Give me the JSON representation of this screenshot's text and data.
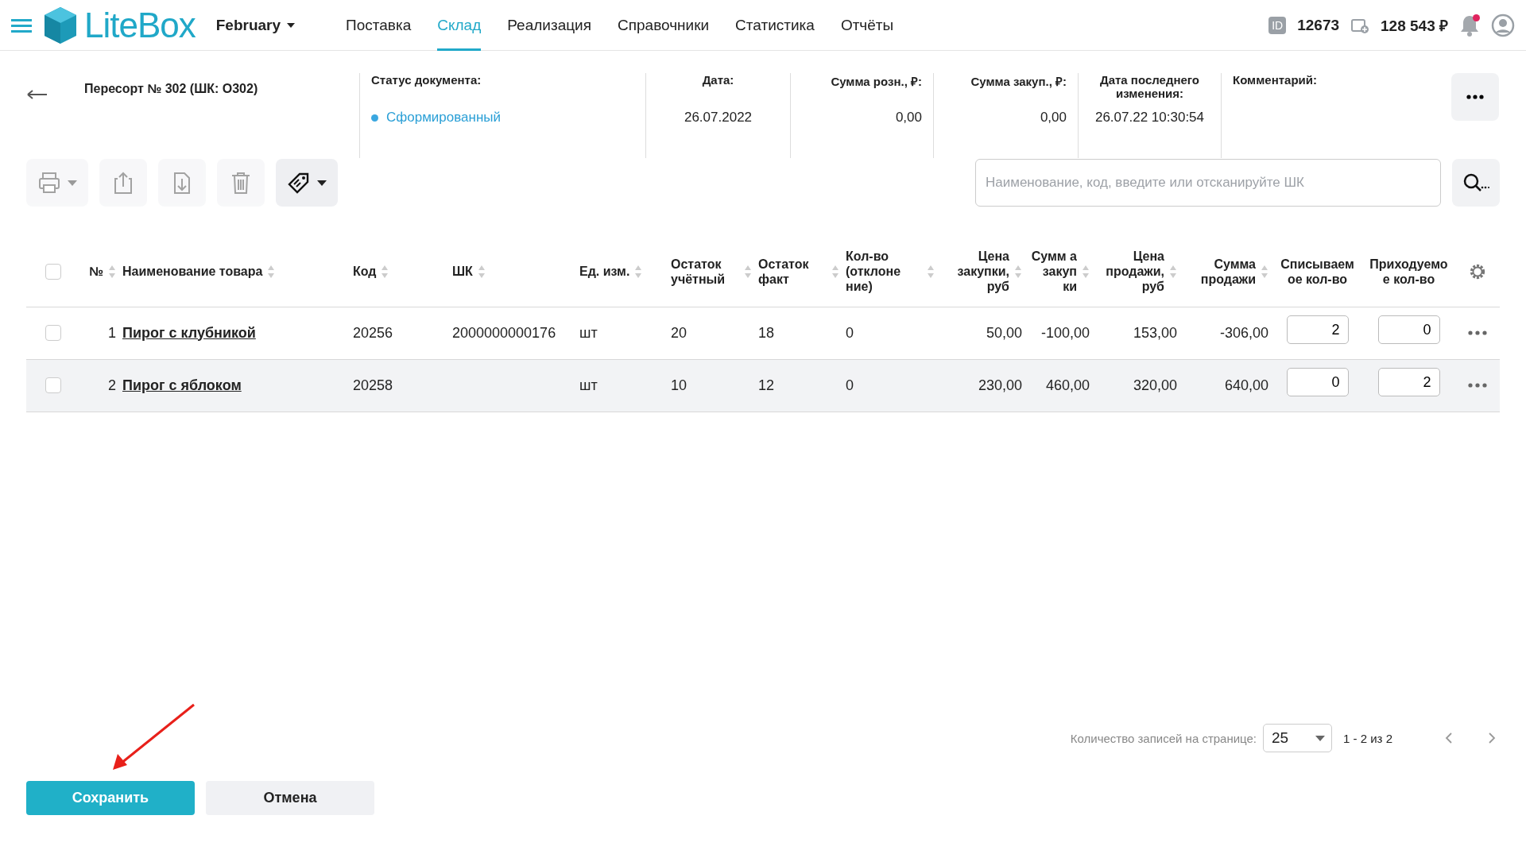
{
  "topbar": {
    "logo": "LiteBox",
    "store": "February",
    "nav": [
      {
        "label": "Поставка",
        "selected": false
      },
      {
        "label": "Склад",
        "selected": true
      },
      {
        "label": "Реализация",
        "selected": false
      },
      {
        "label": "Справочники",
        "selected": false
      },
      {
        "label": "Статистика",
        "selected": false
      },
      {
        "label": "Отчёты",
        "selected": false
      }
    ],
    "id_badge": "ID",
    "id": "12673",
    "balance": "128 543 ₽",
    "notification": true
  },
  "document": {
    "title": "Пересорт № 302 (ШК: О302)",
    "status_label": "Статус документа:",
    "status": "Сформированный",
    "fields": [
      {
        "label": "Дата:",
        "value": "26.07.2022",
        "kind": "center"
      },
      {
        "label": "Сумма розн., ₽:",
        "value": "0,00",
        "kind": "right"
      },
      {
        "label": "Сумма закуп., ₽:",
        "value": "0,00",
        "kind": "right"
      },
      {
        "label": "Дата последнего изменения:",
        "value": "26.07.22 10:30:54",
        "kind": "center"
      }
    ],
    "comment_label": "Комментарий:"
  },
  "toolbar": {
    "buttons": [
      {
        "kind": "print",
        "caret": true,
        "disabled": true
      },
      {
        "kind": "export",
        "caret": false,
        "disabled": true
      },
      {
        "kind": "import",
        "caret": false,
        "disabled": true
      },
      {
        "kind": "delete",
        "caret": false,
        "disabled": true
      },
      {
        "kind": "tag",
        "caret": true,
        "disabled": false
      }
    ],
    "search": {
      "placeholder": "Наименование, код, введите или отсканируйте ШК"
    }
  },
  "table": {
    "select_all": false,
    "columns": [
      {
        "label": "№",
        "kind": "num",
        "sortable": true
      },
      {
        "label": "Наименование товара",
        "kind": "link",
        "sortable": true
      },
      {
        "label": "Код",
        "kind": "text",
        "sortable": true
      },
      {
        "label": "ШК",
        "kind": "text",
        "sortable": true
      },
      {
        "label": "Ед. изм.",
        "kind": "text",
        "sortable": true
      },
      {
        "label": "Остаток учётный",
        "kind": "text",
        "sortable": true
      },
      {
        "label": "Остаток факт",
        "kind": "text",
        "sortable": true
      },
      {
        "label": "Кол-во (отклоне ние)",
        "kind": "text",
        "sortable": true
      },
      {
        "label": "Цена закупки, руб",
        "kind": "number",
        "sortable": true
      },
      {
        "label": "Сумм а закуп ки",
        "kind": "number",
        "sortable": true
      },
      {
        "label": "Цена продажи, руб",
        "kind": "number",
        "sortable": true
      },
      {
        "label": "Сумма продажи",
        "kind": "number",
        "sortable": true
      },
      {
        "label": "Списываем ое кол-во",
        "kind": "input",
        "sortable": false
      },
      {
        "label": "Приходуемо е кол-во",
        "kind": "input",
        "sortable": false
      }
    ],
    "rows": [
      {
        "checked": false,
        "highlighted": false,
        "cells": [
          "1",
          "Пирог с клубникой",
          "20256",
          "2000000000176",
          "шт",
          "20",
          "18",
          "0",
          "50,00",
          "-100,00",
          "153,00",
          "-306,00",
          "2",
          "0"
        ]
      },
      {
        "checked": false,
        "highlighted": true,
        "cells": [
          "2",
          "Пирог с яблоком",
          "20258",
          "",
          "шт",
          "10",
          "12",
          "0",
          "230,00",
          "460,00",
          "320,00",
          "640,00",
          "0",
          "2"
        ]
      }
    ]
  },
  "pagination": {
    "label": "Количество записей на странице:",
    "page_size": "25",
    "range": "1 - 2 из 2"
  },
  "actions": [
    {
      "label": "Сохранить",
      "kind": "primary"
    },
    {
      "label": "Отмена",
      "kind": "secondary"
    }
  ],
  "annotation": {
    "kind": "arrow",
    "color": "#e8201a"
  }
}
